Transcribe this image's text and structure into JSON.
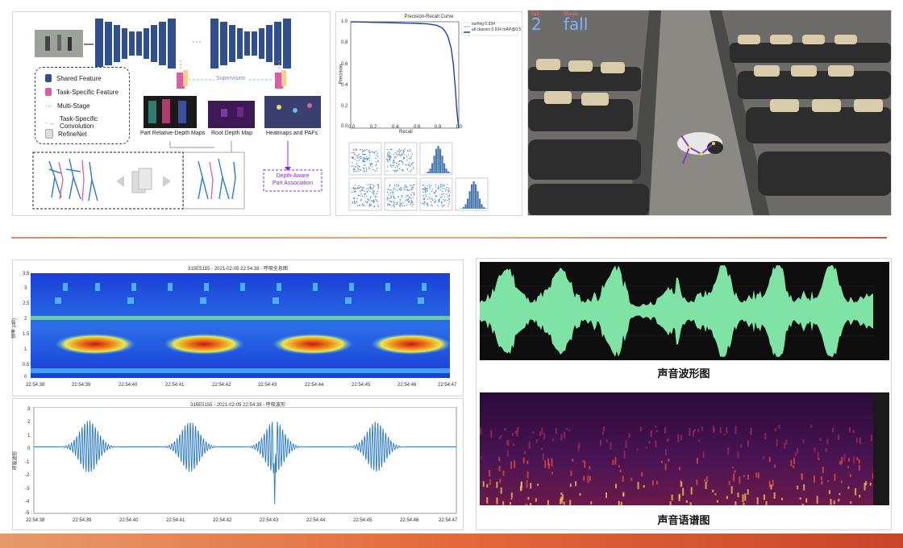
{
  "architecture": {
    "legend": {
      "shared": "Shared Feature",
      "task_specific": "Task-Specific Feature",
      "multi_stage": "Multi-Stage",
      "task_conv": "Task-Specific Convolution",
      "refinenet": "RefineNet"
    },
    "supervision": "Supervision",
    "map_labels": {
      "part_relative": "Part Relative-Depth Maps",
      "root_depth": "Root Depth Map",
      "heatmaps": "Heatmaps and PAFs"
    },
    "association": "Depth-Aware\nPart Association",
    "colors": {
      "navy": "#2f4f8f",
      "pink": "#e05aa6",
      "purple": "#8a2be2"
    }
  },
  "pr_curve": {
    "title": "Precision-Recall Curve",
    "xlabel": "Recall",
    "ylabel": "Precision",
    "legend": [
      "surfing 0.934",
      "all classes 0.934 mAP@0.5"
    ],
    "x_ticks": [
      "0.0",
      "0.2",
      "0.4",
      "0.6",
      "0.8",
      "1.0"
    ],
    "y_ticks": [
      "0.0",
      "0.2",
      "0.4",
      "0.6",
      "0.8",
      "1.0"
    ]
  },
  "video": {
    "frame_label": "Fall",
    "frame_number": "2",
    "stage_label": "Stage",
    "stage_value": "fall"
  },
  "spectrogram_chart": {
    "title": "315E5155 - 2021-02-05 22:54:38 - 呼吸全息图",
    "ylabel": "频率 (dB)",
    "y_ticks": [
      "3.5",
      "3",
      "2.5",
      "2",
      "1.5",
      "1",
      "0.5",
      "0"
    ],
    "x_ticks": [
      "22:54:38",
      "22:54:39",
      "22:54:40",
      "22:54:41",
      "22:54:42",
      "22:54:43",
      "22:54:44",
      "22:54:45",
      "22:54:46",
      "22:54:47"
    ]
  },
  "breath_chart": {
    "title": "315E5155 - 2021-02-05 22:54:38 - 呼吸波形",
    "ylabel": "呼吸波形",
    "y_ticks": [
      "3",
      "2",
      "1",
      "0",
      "-1",
      "-2",
      "-3",
      "-4",
      "-5"
    ],
    "x_ticks": [
      "22:54:38",
      "22:54:39",
      "22:54:40",
      "22:54:41",
      "22:54:42",
      "22:54:43",
      "22:54:44",
      "22:54:45",
      "22:54:46",
      "22:54:47"
    ]
  },
  "audio": {
    "waveform_caption": "声音波形图",
    "spectrogram_caption": "声音语谱图"
  },
  "chart_data": [
    {
      "type": "line",
      "title": "Precision-Recall Curve",
      "xlabel": "Recall",
      "ylabel": "Precision",
      "series": [
        {
          "name": "surfing 0.934",
          "x": [
            0.0,
            0.2,
            0.4,
            0.6,
            0.7,
            0.75,
            0.8,
            0.85,
            0.88,
            0.9,
            0.93,
            0.95,
            0.97,
            0.98,
            0.99,
            1.0
          ],
          "y": [
            1.0,
            0.995,
            0.99,
            0.985,
            0.98,
            0.975,
            0.965,
            0.94,
            0.9,
            0.86,
            0.75,
            0.6,
            0.35,
            0.2,
            0.08,
            0.0
          ]
        }
      ],
      "xlim": [
        0,
        1
      ],
      "ylim": [
        0,
        1
      ]
    },
    {
      "type": "line",
      "title": "315E5155 - 2021-02-05 22:54:38 - 呼吸波形",
      "ylabel": "呼吸波形",
      "ylim": [
        -5,
        3
      ],
      "bursts": [
        {
          "center": "22:54:38.8",
          "amplitude": 2.0
        },
        {
          "center": "22:54:41.3",
          "amplitude": 1.9
        },
        {
          "center": "22:54:43.3",
          "amplitude": 2.0
        },
        {
          "center": "22:54:45.8",
          "amplitude": 1.9
        }
      ],
      "spike": {
        "time": "22:54:43.3",
        "value": -4.3
      }
    }
  ]
}
